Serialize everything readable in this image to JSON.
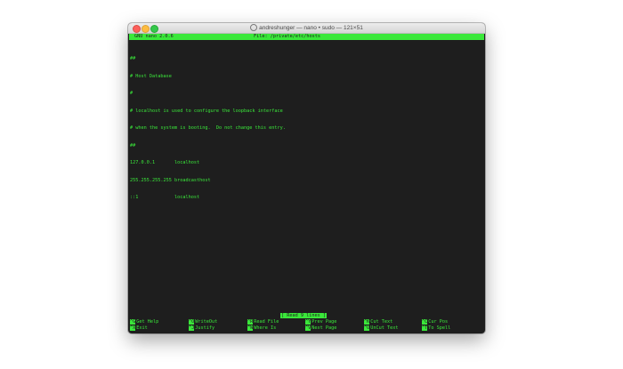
{
  "window": {
    "title": "andreshunger — nano • sudo — 121×51"
  },
  "nano": {
    "version": "GNU nano 2.0.6",
    "file_label": "File: /private/etc/hosts",
    "lines": [
      "##",
      "# Host Database",
      "#",
      "# localhost is used to configure the loopback interface",
      "# when the system is booting.  Do not change this entry.",
      "##",
      "127.0.0.1       localhost",
      "255.255.255.255 broadcasthost",
      "::1             localhost"
    ],
    "status": "[ Read 9 lines ]",
    "shortcuts_row1": [
      {
        "key": "^G",
        "label": "Get Help"
      },
      {
        "key": "^O",
        "label": "WriteOut"
      },
      {
        "key": "^R",
        "label": "Read File"
      },
      {
        "key": "^Y",
        "label": "Prev Page"
      },
      {
        "key": "^K",
        "label": "Cut Text"
      },
      {
        "key": "^C",
        "label": "Cur Pos"
      }
    ],
    "shortcuts_row2": [
      {
        "key": "^X",
        "label": "Exit"
      },
      {
        "key": "^J",
        "label": "Justify"
      },
      {
        "key": "^W",
        "label": "Where Is"
      },
      {
        "key": "^V",
        "label": "Next Page"
      },
      {
        "key": "^U",
        "label": "UnCut Text"
      },
      {
        "key": "^T",
        "label": "To Spell"
      }
    ]
  },
  "colors": {
    "terminal_bg": "#1e1e1e",
    "terminal_fg": "#3ae83a",
    "close": "#fc605b",
    "minimize": "#fdbc40",
    "zoom": "#34c84a"
  }
}
